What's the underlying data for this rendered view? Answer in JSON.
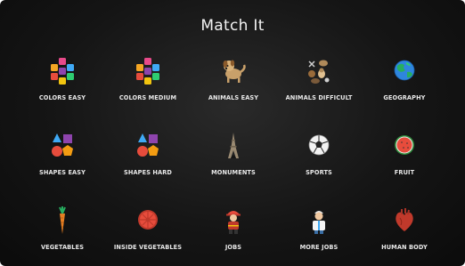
{
  "header": {
    "title": "Match It"
  },
  "categories": [
    {
      "label": "COLORS EASY",
      "icon": "color-blocks-icon"
    },
    {
      "label": "COLORS MEDIUM",
      "icon": "color-blocks-icon"
    },
    {
      "label": "ANIMALS EASY",
      "icon": "dog-icon"
    },
    {
      "label": "ANIMALS DIFFICULT",
      "icon": "animals-icon"
    },
    {
      "label": "GEOGRAPHY",
      "icon": "globe-icon"
    },
    {
      "label": "SHAPES EASY",
      "icon": "shapes-icon"
    },
    {
      "label": "SHAPES HARD",
      "icon": "shapes-icon"
    },
    {
      "label": "MONUMENTS",
      "icon": "eiffel-tower-icon"
    },
    {
      "label": "SPORTS",
      "icon": "soccer-ball-icon"
    },
    {
      "label": "FRUIT",
      "icon": "watermelon-icon"
    },
    {
      "label": "VEGETABLES",
      "icon": "carrot-icon"
    },
    {
      "label": "INSIDE VEGETABLES",
      "icon": "tomato-slice-icon"
    },
    {
      "label": "JOBS",
      "icon": "firefighter-icon"
    },
    {
      "label": "MORE JOBS",
      "icon": "doctor-icon"
    },
    {
      "label": "HUMAN BODY",
      "icon": "heart-icon"
    }
  ],
  "colors": {
    "background": "#151515",
    "text": "#e8e8e8"
  }
}
